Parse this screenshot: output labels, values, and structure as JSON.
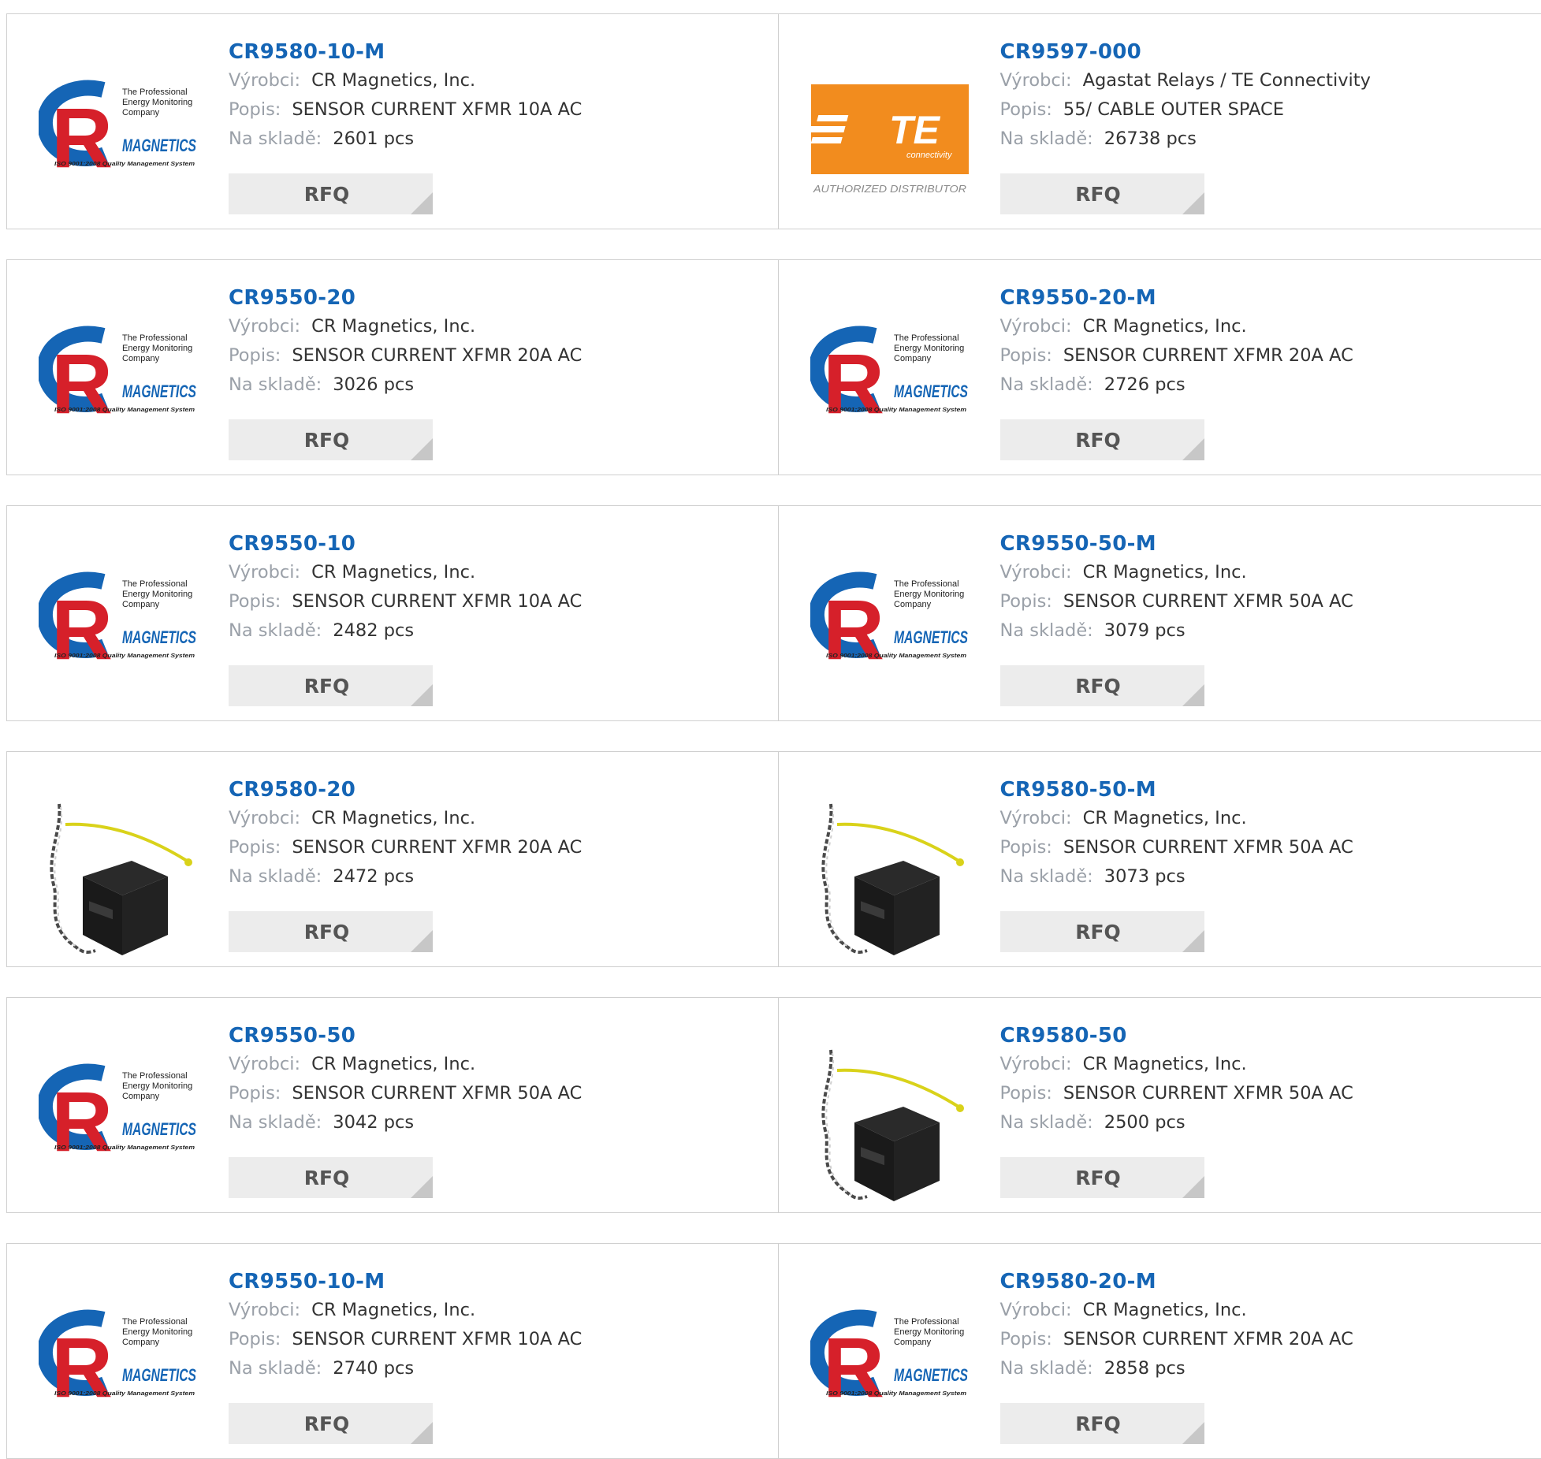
{
  "labels": {
    "manufacturer": "Výrobci:",
    "description": "Popis:",
    "stock": "Na skladě:",
    "rfq": "RFQ"
  },
  "logos": {
    "cr": {
      "line1": "The Professional",
      "line2": "Energy Monitoring",
      "line3": "Company",
      "word": "MAGNETICS",
      "footer": "ISO 9001:2008 Quality Management System"
    },
    "te": {
      "brand": "TE",
      "sub": "connectivity",
      "footer": "AUTHORIZED DISTRIBUTOR"
    }
  },
  "products": [
    {
      "part": "CR9580-10-M",
      "manufacturer": "CR Magnetics, Inc.",
      "description": "SENSOR CURRENT XFMR 10A AC",
      "stock": "2601 pcs",
      "image": "cr-logo"
    },
    {
      "part": "CR9597-000",
      "manufacturer": "Agastat Relays / TE Connectivity",
      "description": "55/ CABLE OUTER SPACE",
      "stock": "26738 pcs",
      "image": "te-logo"
    },
    {
      "part": "CR9550-20",
      "manufacturer": "CR Magnetics, Inc.",
      "description": "SENSOR CURRENT XFMR 20A AC",
      "stock": "3026 pcs",
      "image": "cr-logo"
    },
    {
      "part": "CR9550-20-M",
      "manufacturer": "CR Magnetics, Inc.",
      "description": "SENSOR CURRENT XFMR 20A AC",
      "stock": "2726 pcs",
      "image": "cr-logo"
    },
    {
      "part": "CR9550-10",
      "manufacturer": "CR Magnetics, Inc.",
      "description": "SENSOR CURRENT XFMR 10A AC",
      "stock": "2482 pcs",
      "image": "cr-logo"
    },
    {
      "part": "CR9550-50-M",
      "manufacturer": "CR Magnetics, Inc.",
      "description": "SENSOR CURRENT XFMR 50A AC",
      "stock": "3079 pcs",
      "image": "cr-logo"
    },
    {
      "part": "CR9580-20",
      "manufacturer": "CR Magnetics, Inc.",
      "description": "SENSOR CURRENT XFMR 20A AC",
      "stock": "2472 pcs",
      "image": "sensor-photo"
    },
    {
      "part": "CR9580-50-M",
      "manufacturer": "CR Magnetics, Inc.",
      "description": "SENSOR CURRENT XFMR 50A AC",
      "stock": "3073 pcs",
      "image": "sensor-photo"
    },
    {
      "part": "CR9550-50",
      "manufacturer": "CR Magnetics, Inc.",
      "description": "SENSOR CURRENT XFMR 50A AC",
      "stock": "3042 pcs",
      "image": "cr-logo"
    },
    {
      "part": "CR9580-50",
      "manufacturer": "CR Magnetics, Inc.",
      "description": "SENSOR CURRENT XFMR 50A AC",
      "stock": "2500 pcs",
      "image": "sensor-photo"
    },
    {
      "part": "CR9550-10-M",
      "manufacturer": "CR Magnetics, Inc.",
      "description": "SENSOR CURRENT XFMR 10A AC",
      "stock": "2740 pcs",
      "image": "cr-logo"
    },
    {
      "part": "CR9580-20-M",
      "manufacturer": "CR Magnetics, Inc.",
      "description": "SENSOR CURRENT XFMR 20A AC",
      "stock": "2858 pcs",
      "image": "cr-logo"
    }
  ]
}
